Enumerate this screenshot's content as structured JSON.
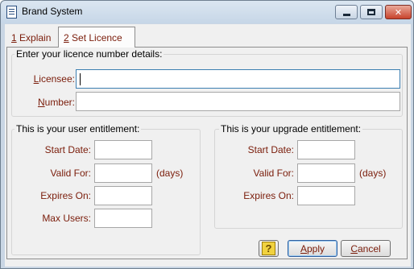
{
  "window": {
    "title": "Brand System",
    "icon": "document-icon",
    "accent": "#7a1c0a",
    "controls": {
      "minimize": "minimize-icon",
      "maximize": "maximize-icon",
      "close": "close-icon"
    }
  },
  "tabs": [
    {
      "key": "1",
      "label": " Explain",
      "active": false
    },
    {
      "key": "2",
      "label": " Set Licence",
      "active": true
    }
  ],
  "licence": {
    "heading": "Enter your licence number details:",
    "licensee_label_key": "L",
    "licensee_label_rest": "icensee:",
    "licensee_value": "",
    "number_label_key": "N",
    "number_label_rest": "umber:",
    "number_value": ""
  },
  "user_entitlement": {
    "heading": "This is your user entitlement:",
    "start_date_label": "Start Date:",
    "start_date_value": "",
    "valid_for_label": "Valid For:",
    "valid_for_value": "",
    "valid_for_unit": "(days)",
    "expires_on_label": "Expires On:",
    "expires_on_value": "",
    "max_users_label": "Max Users:",
    "max_users_value": ""
  },
  "upgrade_entitlement": {
    "heading": "This is your upgrade entitlement:",
    "start_date_label": "Start Date:",
    "start_date_value": "",
    "valid_for_label": "Valid For:",
    "valid_for_value": "",
    "valid_for_unit": "(days)",
    "expires_on_label": "Expires On:",
    "expires_on_value": ""
  },
  "buttons": {
    "help_icon": "help-icon",
    "help_glyph": "?",
    "apply_key": "A",
    "apply_rest": "pply",
    "cancel_key": "C",
    "cancel_rest": "ancel"
  }
}
